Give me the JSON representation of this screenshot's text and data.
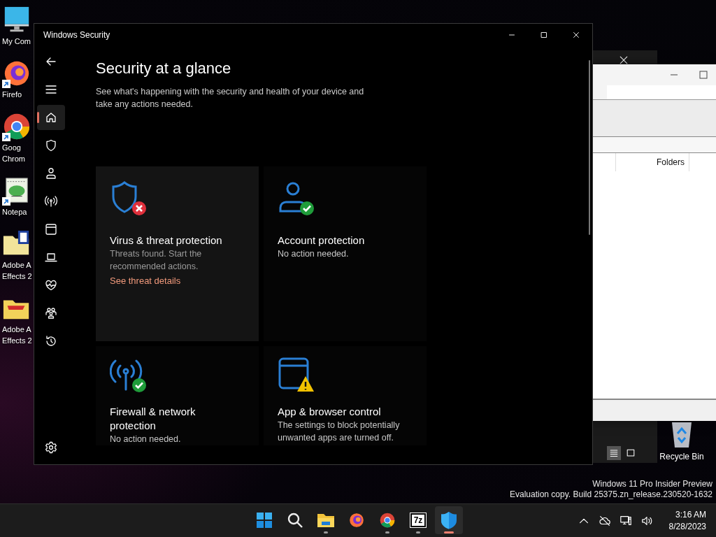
{
  "desktop_icons": [
    {
      "kind": "computer",
      "shortcut": false,
      "lines": [
        "My Com"
      ]
    },
    {
      "kind": "firefox",
      "shortcut": true,
      "lines": [
        "Firefo"
      ]
    },
    {
      "kind": "chrome",
      "shortcut": true,
      "lines": [
        "Goog",
        "Chrom"
      ]
    },
    {
      "kind": "notepad",
      "shortcut": true,
      "lines": [
        "Notepa"
      ]
    },
    {
      "kind": "folder-doc",
      "shortcut": false,
      "lines": [
        "Adobe A",
        "Effects 2"
      ]
    },
    {
      "kind": "folder-red",
      "shortcut": false,
      "lines": [
        "Adobe A",
        "Effects 2"
      ]
    }
  ],
  "recycle_bin": {
    "label": "Recycle Bin"
  },
  "background_window": {
    "column_header": "Folders",
    "views": [
      {
        "kind": "details",
        "selected": true
      },
      {
        "kind": "preview",
        "selected": false
      }
    ]
  },
  "security_window": {
    "title": "Windows Security",
    "nav_items": [
      {
        "kind": "home",
        "selected": true
      },
      {
        "kind": "shield",
        "selected": false
      },
      {
        "kind": "person",
        "selected": false
      },
      {
        "kind": "antenna",
        "selected": false
      },
      {
        "kind": "browser",
        "selected": false
      },
      {
        "kind": "laptop",
        "selected": false
      },
      {
        "kind": "heart",
        "selected": false
      },
      {
        "kind": "family",
        "selected": false
      },
      {
        "kind": "history",
        "selected": false
      }
    ],
    "heading": "Security at a glance",
    "subtitle": "See what's happening with the security and health of your device and take any actions needed.",
    "cards": [
      {
        "kind": "shield",
        "badge": {
          "kind": "error"
        },
        "highlighted": true,
        "title": "Virus & threat protection",
        "description": "Threats found. Start the recommended actions.",
        "link": "See threat details"
      },
      {
        "kind": "person",
        "badge": {
          "kind": "ok"
        },
        "highlighted": false,
        "title": "Account protection",
        "description": "No action needed."
      },
      {
        "kind": "antenna",
        "badge": {
          "kind": "ok"
        },
        "highlighted": false,
        "title": "Firewall & network protection",
        "description": "No action needed."
      },
      {
        "kind": "browser",
        "badge": {
          "kind": "warning"
        },
        "highlighted": false,
        "title": "App & browser control",
        "description": "The settings to block potentially unwanted apps are turned off."
      }
    ]
  },
  "system_notice": [
    "Windows 11 Pro Insider Preview",
    "Evaluation copy. Build 25375.zn_release.230520-1632"
  ],
  "taskbar": {
    "apps": [
      {
        "kind": "start",
        "running": false,
        "active": false
      },
      {
        "kind": "search",
        "running": false,
        "active": false
      },
      {
        "kind": "folder",
        "running": true,
        "active": false
      },
      {
        "kind": "firefox",
        "running": false,
        "active": false
      },
      {
        "kind": "chrome",
        "running": true,
        "active": false
      },
      {
        "kind": "archive",
        "label": "7z",
        "running": true,
        "active": false
      },
      {
        "kind": "security",
        "running": true,
        "active": true
      }
    ],
    "tray": [
      {
        "kind": "chevron"
      },
      {
        "kind": "cloudoff"
      },
      {
        "kind": "network"
      },
      {
        "kind": "volume"
      }
    ],
    "time": "3:16 AM",
    "date": "8/28/2023"
  }
}
